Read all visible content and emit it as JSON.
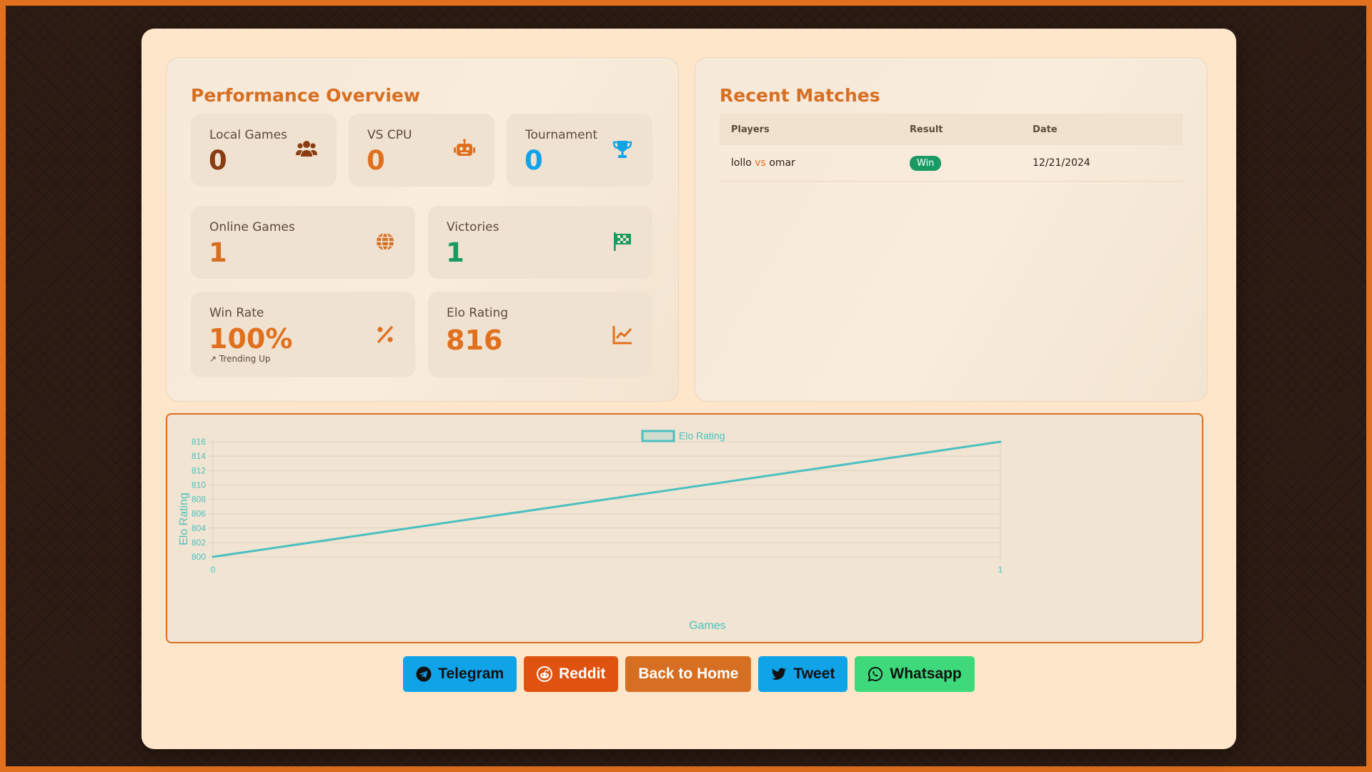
{
  "overview": {
    "title": "Performance Overview",
    "local_games": {
      "label": "Local Games",
      "value": "0",
      "icon": "users-icon"
    },
    "vs_cpu": {
      "label": "VS CPU",
      "value": "0",
      "icon": "robot-icon"
    },
    "tournament": {
      "label": "Tournament",
      "value": "0",
      "icon": "trophy-icon"
    },
    "online_games": {
      "label": "Online Games",
      "value": "1",
      "icon": "globe-icon"
    },
    "victories": {
      "label": "Victories",
      "value": "1",
      "icon": "checkered-flag-icon"
    },
    "win_rate": {
      "label": "Win Rate",
      "value": "100%",
      "sub": "↗ Trending Up",
      "icon": "percent-icon"
    },
    "elo": {
      "label": "Elo Rating",
      "value": "816",
      "icon": "chart-line-icon"
    }
  },
  "recent": {
    "title": "Recent Matches",
    "columns": [
      "Players",
      "Result",
      "Date"
    ],
    "rows": [
      {
        "player1": "lollo",
        "vs": "vs",
        "player2": "omar",
        "result": "Win",
        "date": "12/21/2024"
      }
    ]
  },
  "chart_data": {
    "type": "line",
    "x": [
      0,
      1
    ],
    "series": [
      {
        "name": "Elo Rating",
        "values": [
          800,
          816
        ]
      }
    ],
    "xlabel": "Games",
    "ylabel": "Elo Rating",
    "ylim": [
      800,
      816
    ],
    "yticks": [
      800,
      802,
      804,
      806,
      808,
      810,
      812,
      814,
      816
    ],
    "xticks": [
      0,
      1
    ],
    "legend": "top-center",
    "grid": true,
    "color": "#4bc0c0"
  },
  "share": {
    "telegram": "Telegram",
    "reddit": "Reddit",
    "home": "Back to Home",
    "tweet": "Tweet",
    "whatsapp": "Whatsapp"
  },
  "colors": {
    "accent": "#d76f22",
    "win": "#1a9a62",
    "telegram": "#10a3e8",
    "reddit": "#e0520f",
    "whatsapp": "#3ed97b"
  }
}
